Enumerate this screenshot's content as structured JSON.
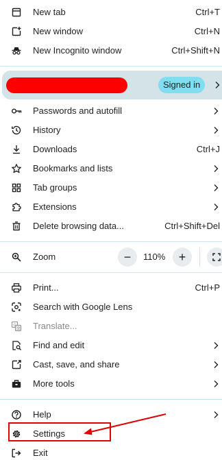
{
  "menu": {
    "top_items": [
      {
        "label": "New tab",
        "shortcut": "Ctrl+T",
        "icon": "new-tab-icon"
      },
      {
        "label": "New window",
        "shortcut": "Ctrl+N",
        "icon": "new-window-icon"
      },
      {
        "label": "New Incognito window",
        "shortcut": "Ctrl+Shift+N",
        "icon": "incognito-icon"
      }
    ],
    "profile": {
      "name": "",
      "badge": "Signed in",
      "redaction_color": "#ff0000"
    },
    "mid_items": [
      {
        "label": "Passwords and autofill",
        "icon": "key-icon",
        "submenu": true
      },
      {
        "label": "History",
        "icon": "history-icon",
        "submenu": true
      },
      {
        "label": "Downloads",
        "shortcut": "Ctrl+J",
        "icon": "download-icon"
      },
      {
        "label": "Bookmarks and lists",
        "icon": "star-icon",
        "submenu": true
      },
      {
        "label": "Tab groups",
        "icon": "tab-groups-icon",
        "submenu": true
      },
      {
        "label": "Extensions",
        "icon": "puzzle-icon",
        "submenu": true
      },
      {
        "label": "Delete browsing data...",
        "shortcut": "Ctrl+Shift+Del",
        "icon": "trash-icon"
      }
    ],
    "zoom": {
      "label": "Zoom",
      "value": "110%",
      "minus": "−",
      "plus": "+"
    },
    "tool_items": [
      {
        "label": "Print...",
        "shortcut": "Ctrl+P",
        "icon": "print-icon"
      },
      {
        "label": "Search with Google Lens",
        "icon": "lens-icon"
      },
      {
        "label": "Translate...",
        "icon": "translate-icon",
        "disabled": true
      },
      {
        "label": "Find and edit",
        "icon": "find-icon",
        "submenu": true
      },
      {
        "label": "Cast, save, and share",
        "icon": "cast-icon",
        "submenu": true
      },
      {
        "label": "More tools",
        "icon": "toolbox-icon",
        "submenu": true
      }
    ],
    "bottom_items": [
      {
        "label": "Help",
        "icon": "help-icon",
        "submenu": true
      },
      {
        "label": "Settings",
        "icon": "gear-icon"
      },
      {
        "label": "Exit",
        "icon": "exit-icon"
      }
    ]
  },
  "annotation": {
    "highlight_color": "#e00000",
    "target": "Settings"
  },
  "colors": {
    "divider": "#c7e7ef",
    "profile_bg": "#d3e3e8",
    "badge_bg": "#80def0"
  }
}
